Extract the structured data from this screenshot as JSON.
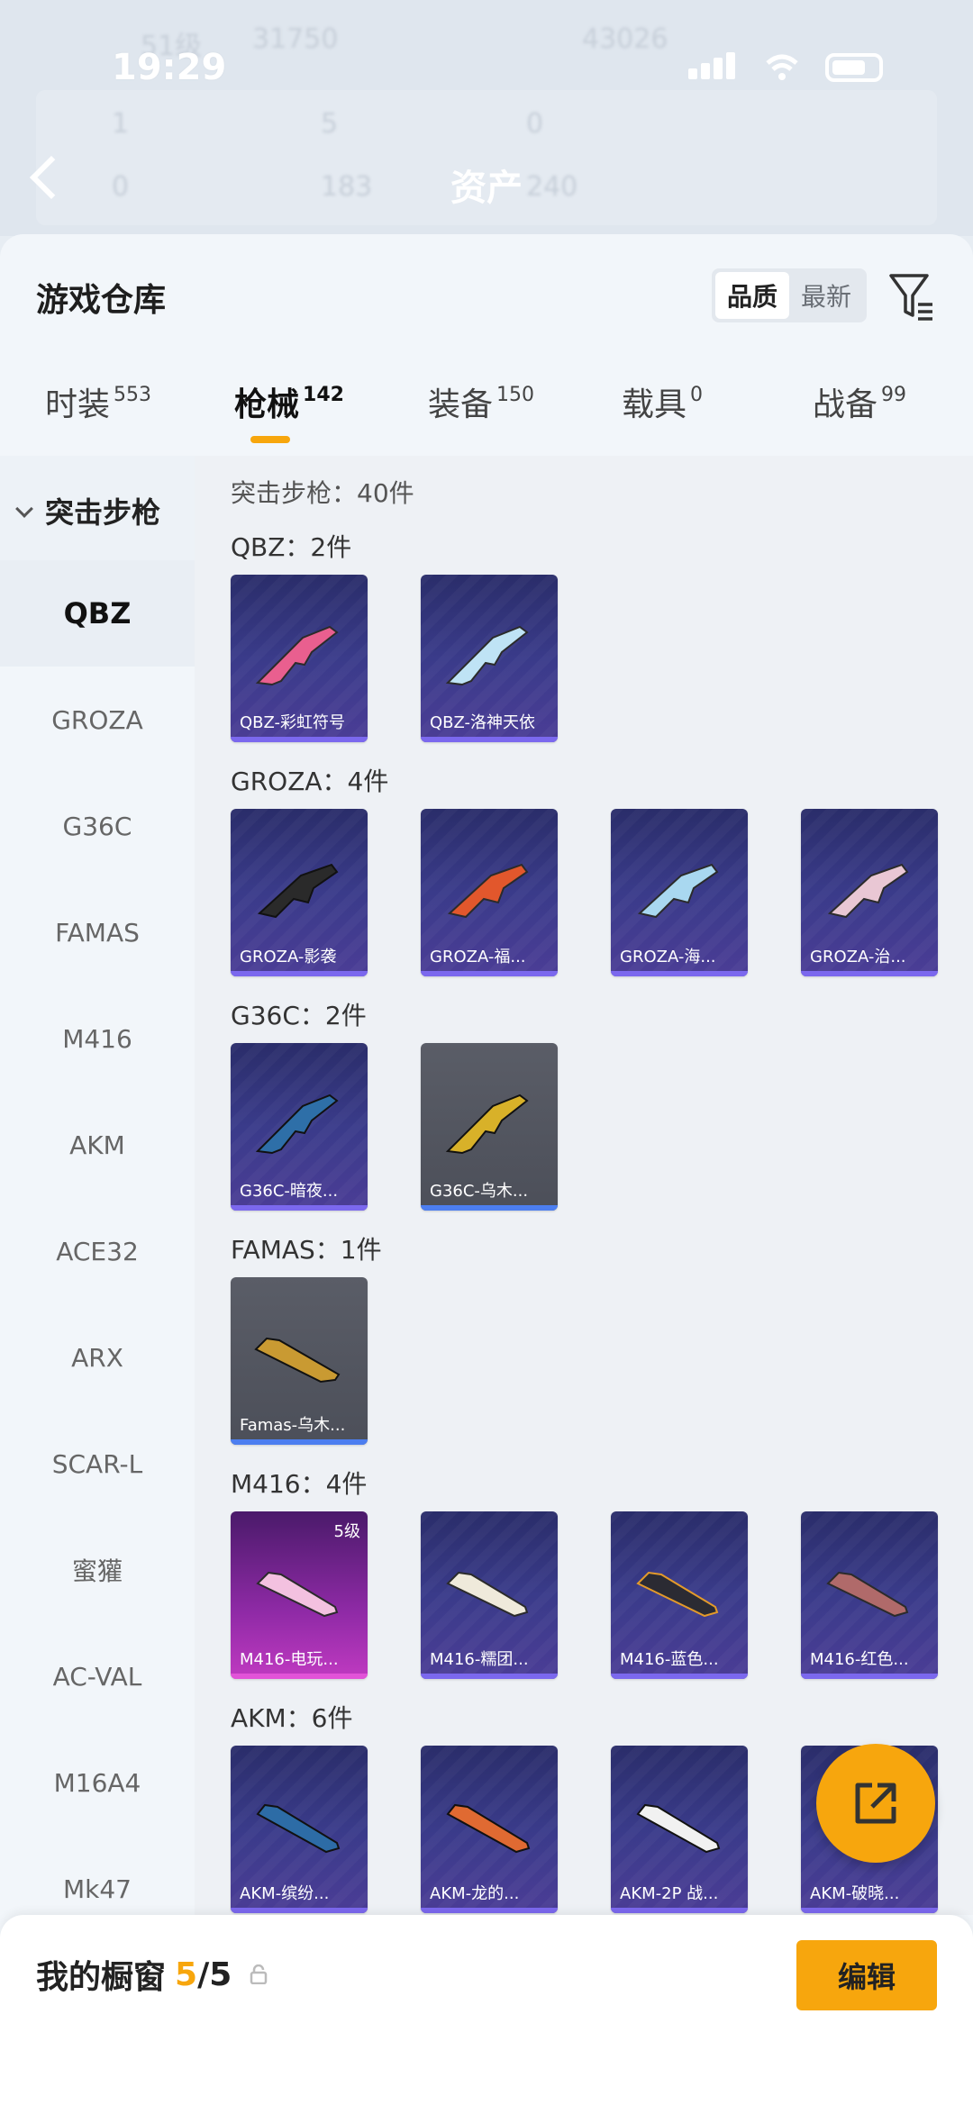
{
  "status_bar": {
    "time": "19:29"
  },
  "background": {
    "row1_left": "51级",
    "row1_right": "31750",
    "row1_right2": "43026",
    "row2_values": [
      "1",
      "5",
      "0"
    ],
    "row3_values": [
      "0",
      "183",
      "240"
    ],
    "title": "资产"
  },
  "sheet": {
    "title": "游戏仓库",
    "sort": {
      "quality": "品质",
      "newest": "最新"
    }
  },
  "tabs": [
    {
      "label": "时装",
      "count": "553"
    },
    {
      "label": "枪械",
      "count": "142"
    },
    {
      "label": "装备",
      "count": "150"
    },
    {
      "label": "载具",
      "count": "0"
    },
    {
      "label": "战备",
      "count": "99"
    }
  ],
  "sidebar": {
    "header": "突击步枪",
    "items": [
      "QBZ",
      "GROZA",
      "G36C",
      "FAMAS",
      "M416",
      "AKM",
      "ACE32",
      "ARX",
      "SCAR-L",
      "蜜獾",
      "AC-VAL",
      "M16A4",
      "Mk47"
    ]
  },
  "main": {
    "count_label": "突击步枪：40件",
    "groups": [
      {
        "title": "QBZ：2件",
        "items": [
          "QBZ-彩虹符号",
          "QBZ-洛神天依"
        ]
      },
      {
        "title": "GROZA：4件",
        "items": [
          "GROZA-影袭",
          "GROZA-福...",
          "GROZA-海...",
          "GROZA-治..."
        ]
      },
      {
        "title": "G36C：2件",
        "items": [
          "G36C-暗夜...",
          "G36C-乌木..."
        ]
      },
      {
        "title": "FAMAS：1件",
        "items": [
          "Famas-乌木..."
        ]
      },
      {
        "title": "M416：4件",
        "items": [
          "M416-电玩...",
          "M416-糯团...",
          "M416-蓝色...",
          "M416-红色..."
        ],
        "level_badge": "5级"
      },
      {
        "title": "AKM：6件",
        "items": [
          "AKM-缤纷...",
          "AKM-龙的...",
          "AKM-2P 战...",
          "AKM-破晓..."
        ]
      }
    ]
  },
  "bottom": {
    "title": "我的橱窗",
    "current": "5",
    "total": "/5",
    "edit": "编辑"
  },
  "colors": {
    "accent": "#f7a60d",
    "card_purple": "#3a3b8a",
    "card_gray": "#5a5d67",
    "card_pink": "#c03ac1"
  }
}
